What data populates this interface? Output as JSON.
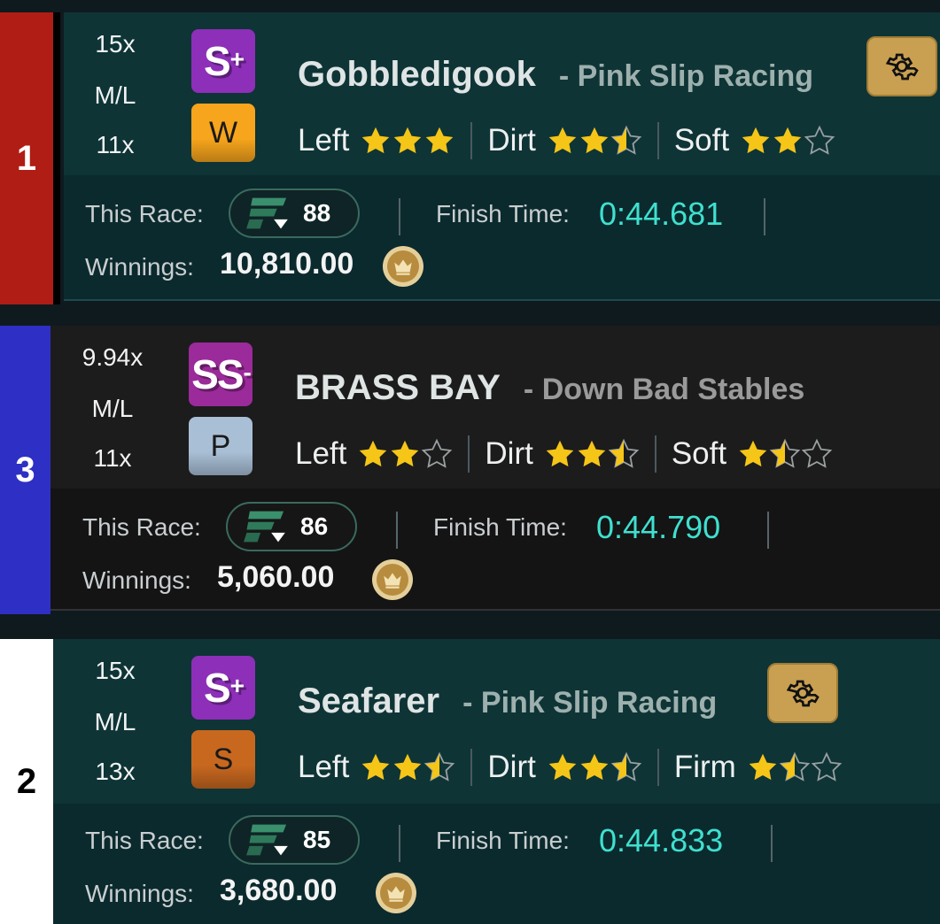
{
  "colors": {
    "teal_bg": "#0e3436",
    "teal_bottom": "#0b2a2d",
    "dark_bg": "#1c1c1c",
    "dark_bottom": "#141414",
    "star": "#f5c518",
    "finish_time": "#3fe0cf",
    "gear_bg": "#c9a052"
  },
  "labels": {
    "ml": "M/L",
    "this_race": "This Race:",
    "finish_time": "Finish Time:",
    "winnings": "Winnings:"
  },
  "entries": [
    {
      "post": "1",
      "post_color": "#b01d14",
      "post_text_color": "#ffffff",
      "odds_top": "15x",
      "odds_bottom": "11x",
      "grade_main": "S",
      "grade_mod": "+",
      "grade_color": "#8d2fb8",
      "class_letter": "W",
      "class_color": "#f7a51c",
      "name": "Gobbledigook",
      "stable": "- Pink Slip Racing",
      "surfaces": [
        {
          "label": "Left",
          "rating": 3
        },
        {
          "label": "Dirt",
          "rating": 2.5
        },
        {
          "label": "Soft",
          "rating": 2
        }
      ],
      "has_gear": true,
      "gear_icon": "gear-icon",
      "rating": "88",
      "finish_time": "0:44.681",
      "winnings": "10,810.00"
    },
    {
      "post": "3",
      "post_color": "#2e2fc4",
      "post_text_color": "#ffffff",
      "odds_top": "9.94x",
      "odds_bottom": "11x",
      "grade_main": "SS",
      "grade_mod": "-",
      "grade_color": "#9b2a9a",
      "class_letter": "P",
      "class_color": "#a9bfd6",
      "name": "BRASS BAY",
      "stable": "- Down Bad Stables",
      "surfaces": [
        {
          "label": "Left",
          "rating": 2
        },
        {
          "label": "Dirt",
          "rating": 2.5
        },
        {
          "label": "Soft",
          "rating": 1.5
        }
      ],
      "has_gear": false,
      "rating": "86",
      "finish_time": "0:44.790",
      "winnings": "5,060.00"
    },
    {
      "post": "2",
      "post_color": "#ffffff",
      "post_text_color": "#000000",
      "odds_top": "15x",
      "odds_bottom": "13x",
      "grade_main": "S",
      "grade_mod": "+",
      "grade_color": "#8d2fb8",
      "class_letter": "S",
      "class_color": "#c8681f",
      "name": "Seafarer",
      "stable": "- Pink Slip Racing",
      "surfaces": [
        {
          "label": "Left",
          "rating": 2.5
        },
        {
          "label": "Dirt",
          "rating": 2.5
        },
        {
          "label": "Firm",
          "rating": 1.5
        }
      ],
      "has_gear": true,
      "gear_icon": "gear-icon",
      "rating": "85",
      "finish_time": "0:44.833",
      "winnings": "3,680.00"
    }
  ]
}
